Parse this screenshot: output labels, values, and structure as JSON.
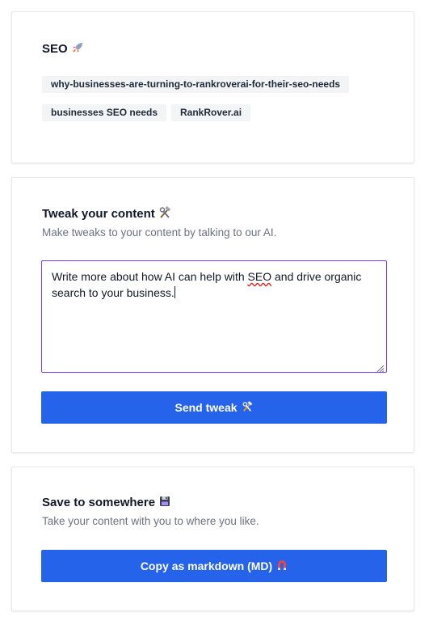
{
  "seo": {
    "title": "SEO",
    "title_icon": "rocket-icon",
    "tags": [
      "why-businesses-are-turning-to-rankroverai-for-their-seo-needs",
      "businesses SEO needs",
      "RankRover.ai"
    ]
  },
  "tweak": {
    "title": "Tweak your content",
    "title_icon": "hammer-wrench-icon",
    "subtitle": "Make tweaks to your content by talking to our AI.",
    "textarea": {
      "value_part1": "Write more about how AI can help with ",
      "value_misspelled": "SEO",
      "value_part2": " and drive organic search to your business."
    },
    "button_label": "Send tweak",
    "button_icon": "hammer-wrench-icon"
  },
  "save": {
    "title": "Save to somewhere",
    "title_icon": "floppy-disk-icon",
    "subtitle": "Take your content with you to where you like.",
    "button_label": "Copy as markdown (MD)",
    "button_icon": "magnet-icon"
  },
  "colors": {
    "primary_button": "#2563eb",
    "textarea_focus_border": "#7c3aed",
    "tag_background": "#f3f4f6",
    "subtitle_text": "#6b7280"
  }
}
